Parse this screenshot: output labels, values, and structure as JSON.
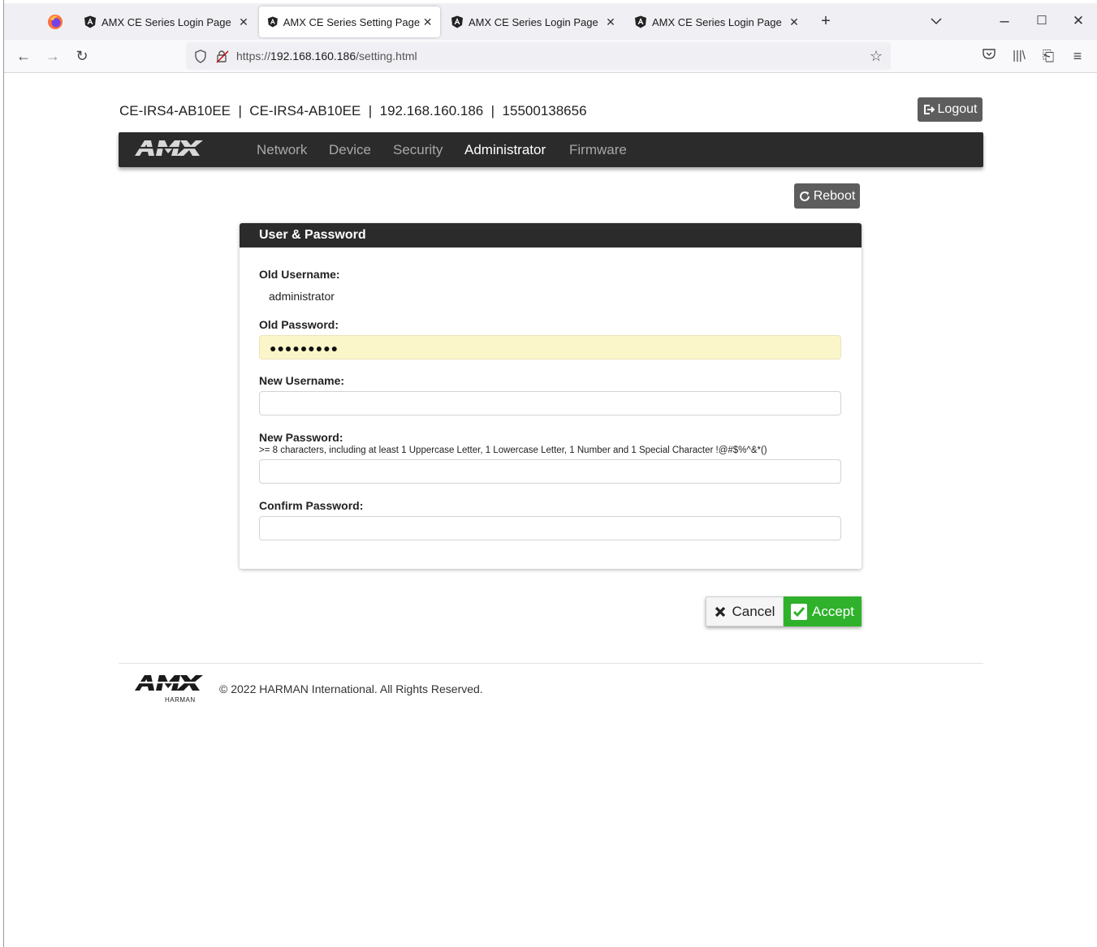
{
  "browser": {
    "tabs": [
      {
        "title": "AMX CE Series Login Page",
        "active": false
      },
      {
        "title": "AMX CE Series Setting Page",
        "active": true
      },
      {
        "title": "AMX CE Series Login Page",
        "active": false
      },
      {
        "title": "AMX CE Series Login Page",
        "active": false
      }
    ],
    "url_prefix": "https://",
    "url_host": "192.168.160.186",
    "url_path": "/setting.html"
  },
  "header": {
    "device_info": "CE-IRS4-AB10EE  |  CE-IRS4-AB10EE  |  192.168.160.186  |  15500138656",
    "logout_label": "Logout"
  },
  "nav": {
    "items": [
      "Network",
      "Device",
      "Security",
      "Administrator",
      "Firmware"
    ],
    "active": "Administrator"
  },
  "reboot_label": "Reboot",
  "panel": {
    "title": "User & Password",
    "old_username_label": "Old Username:",
    "old_username_value": "administrator",
    "old_password_label": "Old Password:",
    "old_password_value": "●●●●●●●●●",
    "new_username_label": "New Username:",
    "new_username_value": "",
    "new_password_label": "New Password:",
    "new_password_hint": ">= 8 characters, including at least 1 Uppercase Letter, 1 Lowercase Letter, 1 Number and 1 Special Character !@#$%^&*()",
    "new_password_value": "",
    "confirm_password_label": "Confirm Password:",
    "confirm_password_value": ""
  },
  "actions": {
    "cancel_label": "Cancel",
    "accept_label": "Accept"
  },
  "footer": {
    "copyright": "© 2022 HARMAN International. All Rights Reserved.",
    "logo_sub": "HARMAN"
  },
  "colors": {
    "nav_bg": "#2b2b2b",
    "accept": "#2fb12b",
    "autofill": "#fbf6c9",
    "button_gray": "#5d5d5d"
  }
}
